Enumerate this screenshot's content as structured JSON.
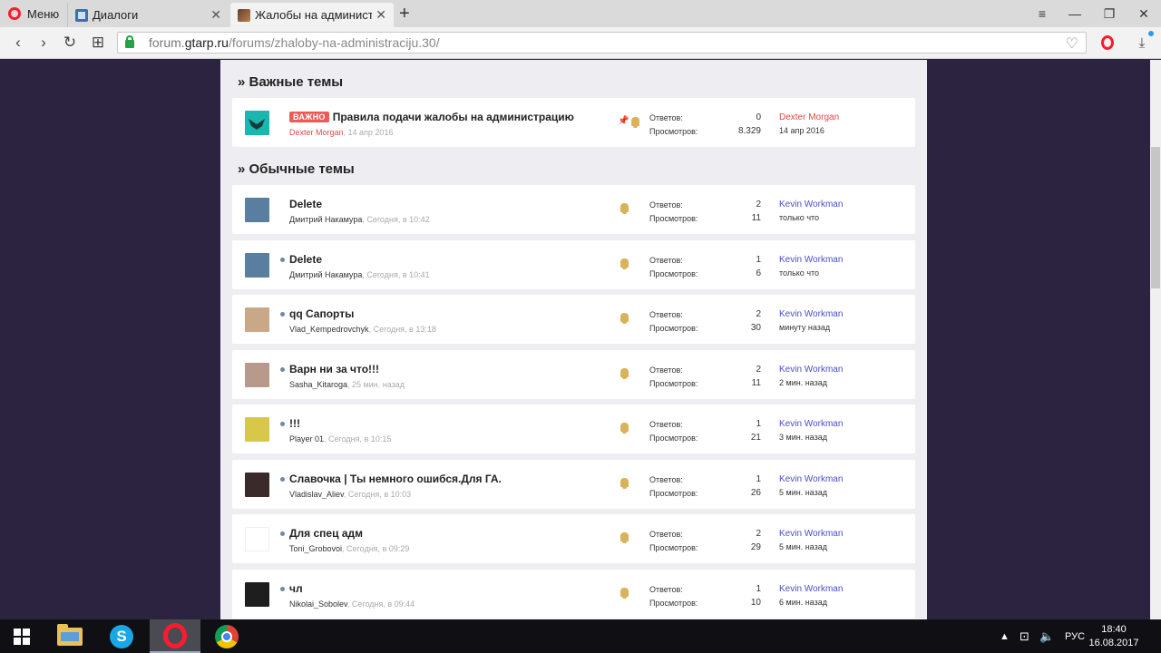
{
  "browser": {
    "menu_label": "Меню",
    "tabs": [
      {
        "label": "Диалоги"
      },
      {
        "label": "Жалобы на администрац"
      }
    ],
    "url": {
      "host": "forum.",
      "domain": "gtarp.ru",
      "path": "/forums/zhaloby-na-administraciju.30/"
    }
  },
  "forum": {
    "important_heading": "» Важные темы",
    "normal_heading": "» Обычные темы",
    "replies_label": "Ответов:",
    "views_label": "Просмотров:",
    "important_threads": [
      {
        "badge": "ВАЖНО",
        "title": "Правила подачи жалобы на администрацию",
        "author": "Dexter Morgan",
        "date": ", 14 апр 2016",
        "replies": "0",
        "views": "8.329",
        "last_user": "Dexter Morgan",
        "last_time": "14 апр 2016",
        "avatar_color": "#19b7b0"
      }
    ],
    "threads": [
      {
        "title": "Delete",
        "author": "Дмитрий Накамура",
        "date": ", Сегодня, в 10:42",
        "replies": "2",
        "views": "11",
        "last_user": "Kevin Workman",
        "last_time": "только что",
        "unread": false,
        "avatar_color": "#5a7ea0"
      },
      {
        "title": "Delete",
        "author": "Дмитрий Накамура",
        "date": ", Сегодня, в 10:41",
        "replies": "1",
        "views": "6",
        "last_user": "Kevin Workman",
        "last_time": "только что",
        "unread": true,
        "avatar_color": "#5a7ea0"
      },
      {
        "title": "qq Сапорты",
        "author": "Vlad_Kempedrovchyk",
        "date": ", Сегодня, в 13:18",
        "replies": "2",
        "views": "30",
        "last_user": "Kevin Workman",
        "last_time": "минуту назад",
        "unread": true,
        "avatar_color": "#c9a88a"
      },
      {
        "title": "Варн ни за что!!!",
        "author": "Sasha_Kitaroga",
        "date": ", 25 мин. назад",
        "replies": "2",
        "views": "11",
        "last_user": "Kevin Workman",
        "last_time": "2 мин. назад",
        "unread": true,
        "avatar_color": "#b89a8c"
      },
      {
        "title": "!!!",
        "author": "Player 01",
        "date": ", Сегодня, в 10:15",
        "replies": "1",
        "views": "21",
        "last_user": "Kevin Workman",
        "last_time": "3 мин. назад",
        "unread": true,
        "avatar_color": "#d8c84a"
      },
      {
        "title": "Славочка | Ты немного ошибся.Для ГА.",
        "author": "Vladislav_Aliev",
        "date": ", Сегодня, в 10:03",
        "replies": "1",
        "views": "26",
        "last_user": "Kevin Workman",
        "last_time": "5 мин. назад",
        "unread": true,
        "avatar_color": "#3a2a2a"
      },
      {
        "title": "Для спец адм",
        "author": "Toni_Grobovoi",
        "date": ", Сегодня, в 09:29",
        "replies": "2",
        "views": "29",
        "last_user": "Kevin Workman",
        "last_time": "5 мин. назад",
        "unread": true,
        "avatar_color": "#ffffff"
      },
      {
        "title": "чл",
        "author": "Nikolai_Sobolev",
        "date": ", Сегодня, в 09:44",
        "replies": "1",
        "views": "10",
        "last_user": "Kevin Workman",
        "last_time": "6 мин. назад",
        "unread": true,
        "avatar_color": "#1e1e1e"
      }
    ]
  },
  "taskbar": {
    "language": "РУС",
    "time": "18:40",
    "date": "16.08.2017"
  }
}
